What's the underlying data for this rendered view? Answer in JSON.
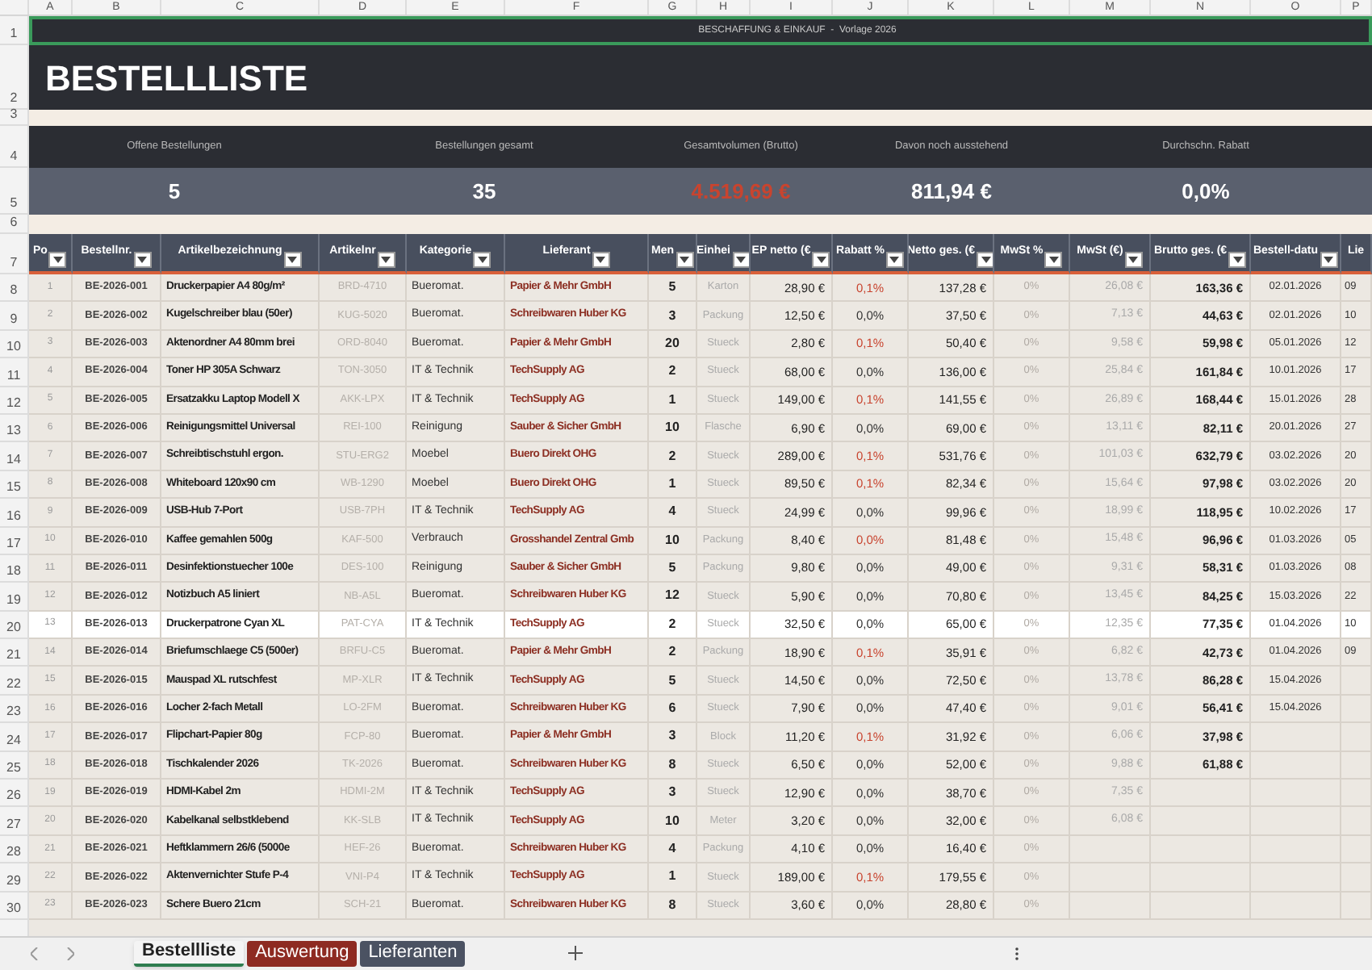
{
  "row_numbers": [
    "1",
    "2",
    "3",
    "4",
    "5",
    "6",
    "7",
    "8",
    "9",
    "10",
    "11",
    "12",
    "13",
    "14",
    "15",
    "16",
    "17",
    "18",
    "19",
    "20",
    "21",
    "22",
    "23",
    "24",
    "25",
    "26",
    "27",
    "28",
    "29",
    "30"
  ],
  "column_letters": [
    "A",
    "B",
    "C",
    "D",
    "E",
    "F",
    "G",
    "H",
    "I",
    "J",
    "K",
    "L",
    "M",
    "N",
    "O",
    "P"
  ],
  "banner": {
    "text": "BESCHAFFUNG & EINKAUF  -  Vorlage 2026",
    "selected": true
  },
  "title": "BESTELLLISTE",
  "kpis": [
    {
      "label": "Offene Bestellungen",
      "value": "5",
      "alert": false
    },
    {
      "label": "Bestellungen gesamt",
      "value": "35",
      "alert": false
    },
    {
      "label": "Gesamtvolumen (Brutto)",
      "value": "4.519,69 €",
      "alert": true
    },
    {
      "label": "Davon noch ausstehend",
      "value": "811,94 €",
      "alert": false
    },
    {
      "label": "Durchschn. Rabatt",
      "value": "0,0%",
      "alert": false
    }
  ],
  "table": {
    "columns": [
      "Po",
      "Bestellnr.",
      "Artikelbezeichnung",
      "Artikelnr",
      "Kategorie",
      "Lieferant",
      "Men",
      "Einhei",
      "EP netto (€",
      "Rabatt %",
      "Netto ges. (€",
      "MwSt %",
      "MwSt (€)",
      "Brutto ges. (€",
      "Bestell-datu",
      "Lie"
    ],
    "rows": [
      {
        "cells": [
          "1",
          "BE-2026-001",
          "Druckerpapier A4 80g/m²",
          "BRD-4710",
          "Bueromat.",
          "Papier & Mehr GmbH",
          "5",
          "Karton",
          "28,90 €",
          "0,1%",
          "137,28 €",
          "0%",
          "26,08 €",
          "163,36 €",
          "02.01.2026",
          "09"
        ],
        "selected": false,
        "discount_flag": true
      },
      {
        "cells": [
          "2",
          "BE-2026-002",
          "Kugelschreiber blau (50er)",
          "KUG-5020",
          "Bueromat.",
          "Schreibwaren Huber KG",
          "3",
          "Packung",
          "12,50 €",
          "0,0%",
          "37,50 €",
          "0%",
          "7,13 €",
          "44,63 €",
          "02.01.2026",
          "10"
        ],
        "selected": false,
        "discount_flag": false
      },
      {
        "cells": [
          "3",
          "BE-2026-003",
          "Aktenordner A4 80mm brei",
          "ORD-8040",
          "Bueromat.",
          "Papier & Mehr GmbH",
          "20",
          "Stueck",
          "2,80 €",
          "0,1%",
          "50,40 €",
          "0%",
          "9,58 €",
          "59,98 €",
          "05.01.2026",
          "12"
        ],
        "selected": false,
        "discount_flag": true
      },
      {
        "cells": [
          "4",
          "BE-2026-004",
          "Toner HP 305A Schwarz",
          "TON-3050",
          "IT & Technik",
          "TechSupply AG",
          "2",
          "Stueck",
          "68,00 €",
          "0,0%",
          "136,00 €",
          "0%",
          "25,84 €",
          "161,84 €",
          "10.01.2026",
          "17"
        ],
        "selected": false,
        "discount_flag": false
      },
      {
        "cells": [
          "5",
          "BE-2026-005",
          "Ersatzakku Laptop Modell X",
          "AKK-LPX",
          "IT & Technik",
          "TechSupply AG",
          "1",
          "Stueck",
          "149,00 €",
          "0,1%",
          "141,55 €",
          "0%",
          "26,89 €",
          "168,44 €",
          "15.01.2026",
          "28"
        ],
        "selected": false,
        "discount_flag": true
      },
      {
        "cells": [
          "6",
          "BE-2026-006",
          "Reinigungsmittel Universal",
          "REI-100",
          "Reinigung",
          "Sauber & Sicher GmbH",
          "10",
          "Flasche",
          "6,90 €",
          "0,0%",
          "69,00 €",
          "0%",
          "13,11 €",
          "82,11 €",
          "20.01.2026",
          "27"
        ],
        "selected": false,
        "discount_flag": false
      },
      {
        "cells": [
          "7",
          "BE-2026-007",
          "Schreibtischstuhl ergon.",
          "STU-ERG2",
          "Moebel",
          "Buero Direkt OHG",
          "2",
          "Stueck",
          "289,00 €",
          "0,1%",
          "531,76 €",
          "0%",
          "101,03 €",
          "632,79 €",
          "03.02.2026",
          "20"
        ],
        "selected": false,
        "discount_flag": true
      },
      {
        "cells": [
          "8",
          "BE-2026-008",
          "Whiteboard 120x90 cm",
          "WB-1290",
          "Moebel",
          "Buero Direkt OHG",
          "1",
          "Stueck",
          "89,50 €",
          "0,1%",
          "82,34 €",
          "0%",
          "15,64 €",
          "97,98 €",
          "03.02.2026",
          "20"
        ],
        "selected": false,
        "discount_flag": true
      },
      {
        "cells": [
          "9",
          "BE-2026-009",
          "USB-Hub 7-Port",
          "USB-7PH",
          "IT & Technik",
          "TechSupply AG",
          "4",
          "Stueck",
          "24,99 €",
          "0,0%",
          "99,96 €",
          "0%",
          "18,99 €",
          "118,95 €",
          "10.02.2026",
          "17"
        ],
        "selected": false,
        "discount_flag": false
      },
      {
        "cells": [
          "10",
          "BE-2026-010",
          "Kaffee gemahlen 500g",
          "KAF-500",
          "Verbrauch",
          "Grosshandel Zentral Gmb",
          "10",
          "Packung",
          "8,40 €",
          "0,0%",
          "81,48 €",
          "0%",
          "15,48 €",
          "96,96 €",
          "01.03.2026",
          "05"
        ],
        "selected": false,
        "discount_flag": true
      },
      {
        "cells": [
          "11",
          "BE-2026-011",
          "Desinfektionstuecher 100e",
          "DES-100",
          "Reinigung",
          "Sauber & Sicher GmbH",
          "5",
          "Packung",
          "9,80 €",
          "0,0%",
          "49,00 €",
          "0%",
          "9,31 €",
          "58,31 €",
          "01.03.2026",
          "08"
        ],
        "selected": false,
        "discount_flag": false
      },
      {
        "cells": [
          "12",
          "BE-2026-012",
          "Notizbuch A5 liniert",
          "NB-A5L",
          "Bueromat.",
          "Schreibwaren Huber KG",
          "12",
          "Stueck",
          "5,90 €",
          "0,0%",
          "70,80 €",
          "0%",
          "13,45 €",
          "84,25 €",
          "15.03.2026",
          "22"
        ],
        "selected": false,
        "discount_flag": false
      },
      {
        "cells": [
          "13",
          "BE-2026-013",
          "Druckerpatrone Cyan XL",
          "PAT-CYA",
          "IT & Technik",
          "TechSupply AG",
          "2",
          "Stueck",
          "32,50 €",
          "0,0%",
          "65,00 €",
          "0%",
          "12,35 €",
          "77,35 €",
          "01.04.2026",
          "10"
        ],
        "selected": true,
        "discount_flag": false
      },
      {
        "cells": [
          "14",
          "BE-2026-014",
          "Briefumschlaege C5 (500er)",
          "BRFU-C5",
          "Bueromat.",
          "Papier & Mehr GmbH",
          "2",
          "Packung",
          "18,90 €",
          "0,1%",
          "35,91 €",
          "0%",
          "6,82 €",
          "42,73 €",
          "01.04.2026",
          "09"
        ],
        "selected": false,
        "discount_flag": true
      },
      {
        "cells": [
          "15",
          "BE-2026-015",
          "Mauspad XL rutschfest",
          "MP-XLR",
          "IT & Technik",
          "TechSupply AG",
          "5",
          "Stueck",
          "14,50 €",
          "0,0%",
          "72,50 €",
          "0%",
          "13,78 €",
          "86,28 €",
          "15.04.2026",
          null
        ],
        "selected": false,
        "discount_flag": false
      },
      {
        "cells": [
          "16",
          "BE-2026-016",
          "Locher 2-fach Metall",
          "LO-2FM",
          "Bueromat.",
          "Schreibwaren Huber KG",
          "6",
          "Stueck",
          "7,90 €",
          "0,0%",
          "47,40 €",
          "0%",
          "9,01 €",
          "56,41 €",
          "15.04.2026",
          null
        ],
        "selected": false,
        "discount_flag": false
      },
      {
        "cells": [
          "17",
          "BE-2026-017",
          "Flipchart-Papier 80g",
          "FCP-80",
          "Bueromat.",
          "Papier & Mehr GmbH",
          "3",
          "Block",
          "11,20 €",
          "0,1%",
          "31,92 €",
          "0%",
          "6,06 €",
          "37,98 €",
          null,
          null
        ],
        "selected": false,
        "discount_flag": true
      },
      {
        "cells": [
          "18",
          "BE-2026-018",
          "Tischkalender 2026",
          "TK-2026",
          "Bueromat.",
          "Schreibwaren Huber KG",
          "8",
          "Stueck",
          "6,50 €",
          "0,0%",
          "52,00 €",
          "0%",
          "9,88 €",
          "61,88 €",
          null,
          null
        ],
        "selected": false,
        "discount_flag": false
      },
      {
        "cells": [
          "19",
          "BE-2026-019",
          "HDMI-Kabel 2m",
          "HDMI-2M",
          "IT & Technik",
          "TechSupply AG",
          "3",
          "Stueck",
          "12,90 €",
          "0,0%",
          "38,70 €",
          "0%",
          "7,35 €",
          null,
          null,
          null
        ],
        "selected": false,
        "discount_flag": false
      },
      {
        "cells": [
          "20",
          "BE-2026-020",
          "Kabelkanal selbstklebend",
          "KK-SLB",
          "IT & Technik",
          "TechSupply AG",
          "10",
          "Meter",
          "3,20 €",
          "0,0%",
          "32,00 €",
          "0%",
          "6,08 €",
          null,
          null,
          null
        ],
        "selected": false,
        "discount_flag": false
      },
      {
        "cells": [
          "21",
          "BE-2026-021",
          "Heftklammern 26/6 (5000e",
          "HEF-26",
          "Bueromat.",
          "Schreibwaren Huber KG",
          "4",
          "Packung",
          "4,10 €",
          "0,0%",
          "16,40 €",
          "0%",
          null,
          null,
          null,
          null
        ],
        "selected": false,
        "discount_flag": false
      },
      {
        "cells": [
          "22",
          "BE-2026-022",
          "Aktenvernichter Stufe P-4",
          "VNI-P4",
          "IT & Technik",
          "TechSupply AG",
          "1",
          "Stueck",
          "189,00 €",
          "0,1%",
          "179,55 €",
          "0%",
          null,
          null,
          null,
          null
        ],
        "selected": false,
        "discount_flag": true
      },
      {
        "cells": [
          "23",
          "BE-2026-023",
          "Schere Buero 21cm",
          "SCH-21",
          "Bueromat.",
          "Schreibwaren Huber KG",
          "8",
          "Stueck",
          "3,60 €",
          "0,0%",
          "28,80 €",
          "0%",
          null,
          null,
          null,
          null
        ],
        "selected": false,
        "discount_flag": false
      }
    ]
  },
  "sheet_tabs": [
    {
      "label": "Bestellliste",
      "selected": true,
      "color": "#f4f4f4"
    },
    {
      "label": "Auswertung",
      "selected": false,
      "color": "#8e2b22"
    },
    {
      "label": "Lieferanten",
      "selected": false,
      "color": "#4b5262"
    }
  ]
}
